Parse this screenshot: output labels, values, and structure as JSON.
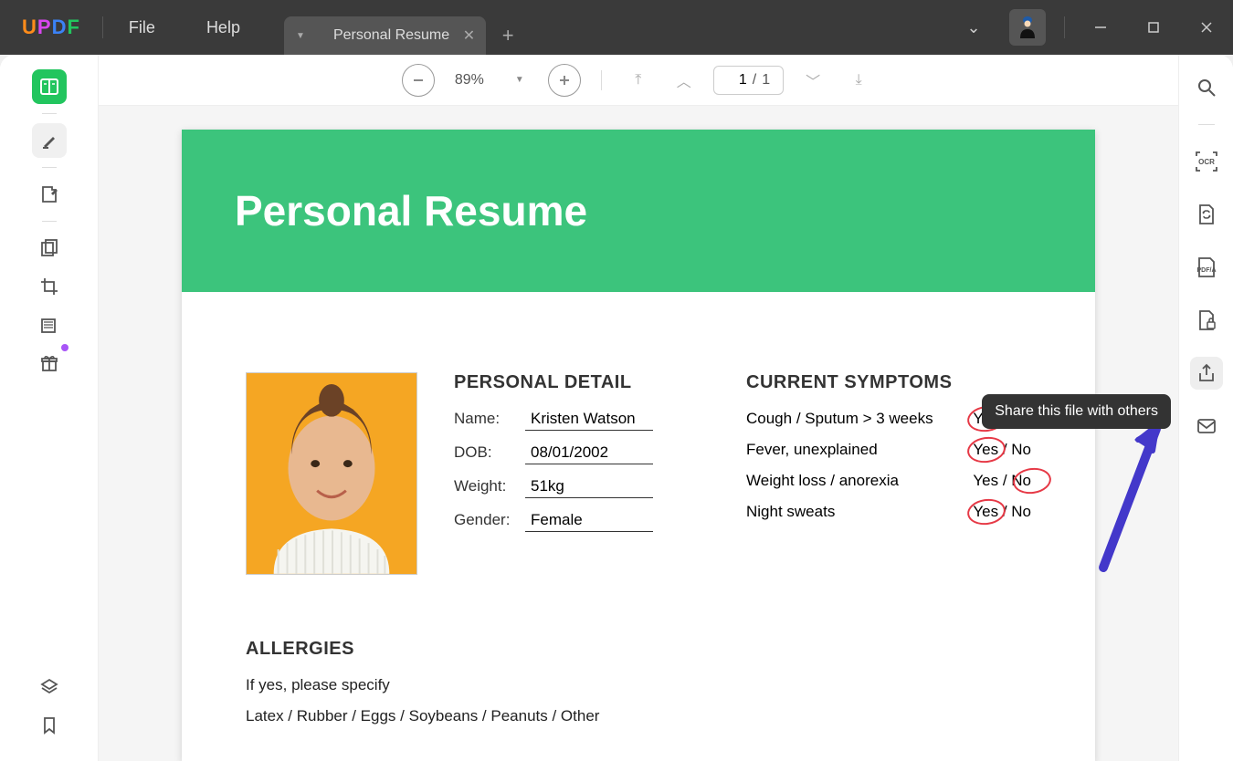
{
  "app": {
    "logo_letters": [
      "U",
      "P",
      "D",
      "F"
    ],
    "menus": {
      "file": "File",
      "help": "Help"
    },
    "tab_title": "Personal Resume"
  },
  "toolbar": {
    "zoom": "89%",
    "current_page": "1",
    "total_pages": "1",
    "page_sep": "/"
  },
  "document": {
    "title": "Personal Resume",
    "personal_detail": {
      "heading": "PERSONAL DETAIL",
      "name_label": "Name:",
      "name_value": "Kristen Watson",
      "dob_label": "DOB:",
      "dob_value": "08/01/2002",
      "weight_label": "Weight:",
      "weight_value": "51kg",
      "gender_label": "Gender:",
      "gender_value": "Female"
    },
    "symptoms": {
      "heading": "CURRENT SYMPTOMS",
      "rows": [
        {
          "label": "Cough / Sputum > 3 weeks",
          "answer": "Yes / No",
          "circled": "yes"
        },
        {
          "label": "Fever, unexplained",
          "answer": "Yes / No",
          "circled": "yes"
        },
        {
          "label": "Weight loss / anorexia",
          "answer": "Yes / No",
          "circled": "no"
        },
        {
          "label": "Night sweats",
          "answer": "Yes / No",
          "circled": "yes"
        }
      ]
    },
    "allergies": {
      "heading": "ALLERGIES",
      "line1": "If yes, please specify",
      "line2": "Latex / Rubber / Eggs / Soybeans / Peanuts / Other"
    }
  },
  "tooltip": {
    "share": "Share this file with others"
  },
  "right_icons": {
    "ocr_text": "OCR",
    "pdfa_text": "PDF/A"
  }
}
